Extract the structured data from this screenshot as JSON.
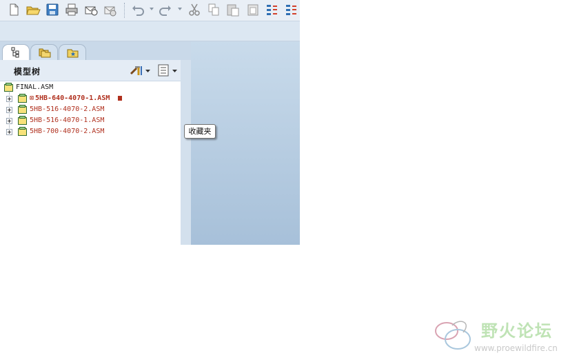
{
  "toolbar": {
    "buttons": [
      "new-file-icon",
      "open-folder-icon",
      "save-icon",
      "print-icon",
      "mail-icon",
      "mail-attach-icon"
    ],
    "edit_buttons": [
      "undo-icon",
      "redo-icon",
      "cut-icon",
      "copy-icon",
      "paste-icon",
      "paste-special-icon",
      "regenerate-icon",
      "regenerate-manager-icon"
    ]
  },
  "tabs": [
    {
      "name": "model-tree-tab",
      "icon": "tree-structure-icon",
      "active": true
    },
    {
      "name": "folder-browser-tab",
      "icon": "folders-icon",
      "active": false
    },
    {
      "name": "favorites-tab",
      "icon": "star-folder-icon",
      "active": false
    }
  ],
  "model_tree": {
    "title": "模型树",
    "settings_icon": "tools-icon",
    "show_icon": "list-settings-icon",
    "root": "FINAL.ASM",
    "items": [
      {
        "label": "5HB-640-4070-1.ASM",
        "marker": "⊠",
        "active": true
      },
      {
        "label": "5HB-516-4070-2.ASM",
        "marker": "",
        "active": false
      },
      {
        "label": "5HB-516-4070-1.ASM",
        "marker": "",
        "active": false
      },
      {
        "label": "5HB-700-4070-2.ASM",
        "marker": "",
        "active": false
      }
    ]
  },
  "tooltip": "收藏夹",
  "watermark": {
    "cn": "野火论坛",
    "url": "www.proewildfire.cn"
  },
  "colors": {
    "item_text": "#b0301e",
    "accent": "#2f6fb3",
    "canvas_top": "#c9dbeb",
    "canvas_bottom": "#a7c0d9"
  }
}
